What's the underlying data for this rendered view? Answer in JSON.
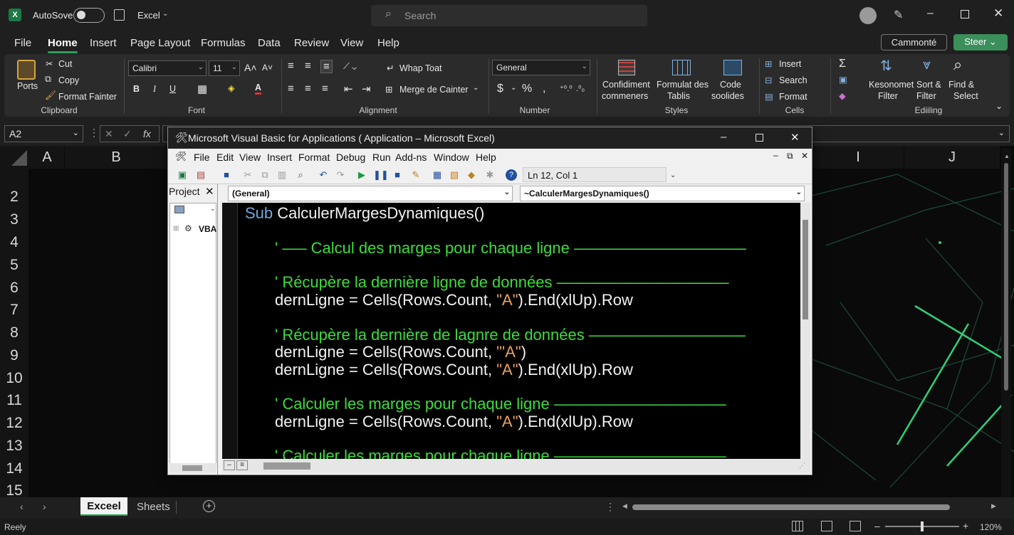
{
  "app": {
    "autosave_label": "AutoSove",
    "doc_name": "Excel",
    "search_placeholder": "Search"
  },
  "menu": {
    "tabs": [
      "File",
      "Home",
      "Insert",
      "Page Layout",
      "Formulas",
      "Data",
      "Review",
      "View",
      "Help"
    ],
    "comment_btn": "Cammonté",
    "share_btn": "Steer"
  },
  "ribbon": {
    "clipboard": {
      "paste": "Ports",
      "cut": "Cut",
      "copy": "Copy",
      "format_painter": "Format Fainter",
      "label": "Clipboard"
    },
    "font": {
      "name": "Calibri",
      "size": "11",
      "label": "Font",
      "bold": "B",
      "italic": "I",
      "underline": "U"
    },
    "alignment": {
      "wrap": "Whap Toat",
      "merge": "Merge de Cainter",
      "label": "Alignment"
    },
    "number": {
      "format": "General",
      "label": "Number",
      "currency": "$",
      "percent": "%"
    },
    "styles": {
      "conditional_l1": "Confidiment",
      "conditional_l2": "commeners",
      "format_table_l1": "Formulat des",
      "format_table_l2": "Tablis",
      "cell_styles_l1": "Code",
      "cell_styles_l2": "soolides",
      "label": "Styles"
    },
    "cells": {
      "insert": "Insert",
      "delete": "Search",
      "format": "Format",
      "label": "Cells"
    },
    "editing": {
      "sort_l1": "Kesonomet",
      "sort_l2": "Filter",
      "filter_l1": "Sort &",
      "filter_l2": "Filter",
      "find_l1": "Find &",
      "find_l2": "Select",
      "label": "Ediiling",
      "sum": "Σ"
    }
  },
  "formula_bar": {
    "name_box": "A2",
    "fx": "fx"
  },
  "grid": {
    "columns": [
      "A",
      "B",
      "I",
      "J"
    ],
    "rows": [
      "2",
      "3",
      "4",
      "5",
      "6",
      "7",
      "8",
      "9",
      "10",
      "11",
      "12",
      "13",
      "14",
      "15"
    ]
  },
  "sheets": {
    "active": "Exceel",
    "other": "Sheets"
  },
  "status": {
    "ready": "Reely",
    "zoom": "120%"
  },
  "vbe": {
    "title": "Microsoft Visual Basic for Applications ( Application – Microsoft Excel)",
    "menu": [
      "File",
      "Edit",
      "View",
      "Insert",
      "Format",
      "Debug",
      "Run",
      "Add-ns",
      "Window",
      "Help"
    ],
    "position": "Ln 12, Col 1",
    "project_label": "Project",
    "project_item": "VBA",
    "object_combo": "(General)",
    "proc_combo": "~CalculerMargesDynamiques()",
    "code": {
      "sub_kw": "Sub",
      "sub_name": "CalculerMargesDynamiques()",
      "c1": "' —– Calcul des marges pour chaque ligne ———————————",
      "c2": "'  Récupère la dernière ligne de données ———————————",
      "l2a": "dernLigne = Cells(Rows.Count, ",
      "l2s": "\"A\"",
      "l2b": ").End(xlUp).Row",
      "c3": "'  Récupère la dernière de lagnre de données ——————————",
      "l3a": "dernLigne = Cells(Rows.Count, ",
      "l3s": "\"'A\"",
      "l3b": ")",
      "l4a": "dernLigne = Cells(Rows.Count, ",
      "l4s": "\"A\"",
      "l4b": ").End(xlUp).Row",
      "c4": "'  Calculer les marges pour chaque ligne ———————————",
      "l5a": "dernLigne = Cells(Rows.Count, ",
      "l5s": "\"A\"",
      "l5b": ").End(xlUp).Row",
      "c5": "'  Calculer les marges pour chaque ligne ———————————"
    }
  }
}
